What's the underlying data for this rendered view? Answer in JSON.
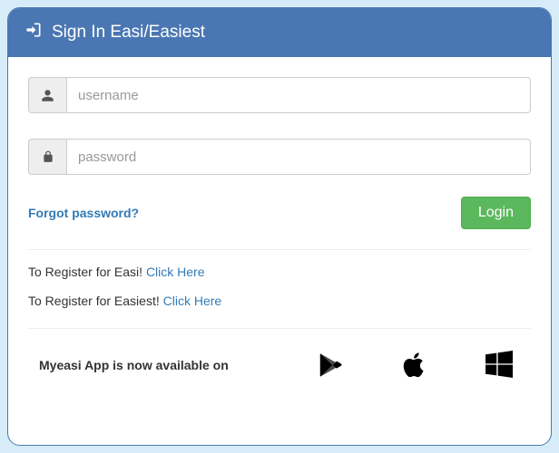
{
  "header": {
    "title": "Sign In Easi/Easiest"
  },
  "form": {
    "username": {
      "placeholder": "username",
      "value": ""
    },
    "password": {
      "placeholder": "password",
      "value": ""
    },
    "forgot_label": "Forgot password?",
    "login_label": "Login"
  },
  "register": {
    "easi_text": "To Register for Easi! ",
    "easi_link": "Click Here",
    "easiest_text": "To Register for Easiest! ",
    "easiest_link": "Click Here"
  },
  "app_promo": {
    "text": "Myeasi App is now available on"
  },
  "icons": {
    "signin": "signin-arrow",
    "user": "user-icon",
    "lock": "lock-icon",
    "play": "google-play-icon",
    "apple": "apple-icon",
    "windows": "windows-icon"
  }
}
